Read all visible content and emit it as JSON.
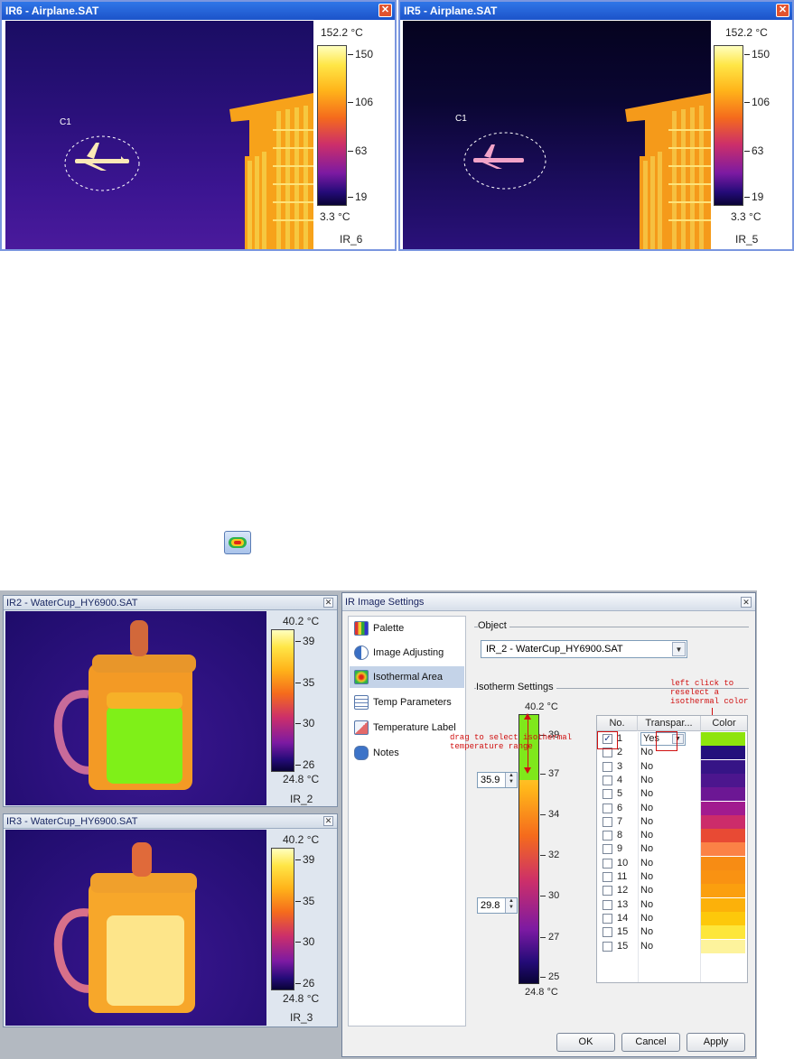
{
  "top_left_window": {
    "title": "IR6 - Airplane.SAT",
    "max_label": "152.2 °C",
    "min_label": "3.3 °C",
    "ticks": [
      "150",
      "106",
      "63",
      "19"
    ],
    "image_name": "IR_6",
    "region_label": "C1"
  },
  "top_right_window": {
    "title": "IR5 - Airplane.SAT",
    "max_label": "152.2 °C",
    "min_label": "3.3 °C",
    "ticks": [
      "150",
      "106",
      "63",
      "19"
    ],
    "image_name": "IR_5",
    "region_label": "C1"
  },
  "isothermal_toolbar_icon": "isothermal-area-icon",
  "cup_window_top": {
    "title": "IR2 - WaterCup_HY6900.SAT",
    "max_label": "40.2 °C",
    "min_label": "24.8 °C",
    "ticks": [
      "39",
      "35",
      "30",
      "26"
    ],
    "image_name": "IR_2"
  },
  "cup_window_bottom": {
    "title": "IR3 - WaterCup_HY6900.SAT",
    "max_label": "40.2 °C",
    "min_label": "24.8 °C",
    "ticks": [
      "39",
      "35",
      "30",
      "26"
    ],
    "image_name": "IR_3"
  },
  "dialog": {
    "title": "IR Image Settings",
    "nav": [
      {
        "label": "Palette",
        "icon": "palette-icon"
      },
      {
        "label": "Image Adjusting",
        "icon": "contrast-icon"
      },
      {
        "label": "Isothermal Area",
        "icon": "isothermal-icon",
        "selected": true
      },
      {
        "label": "Temp Parameters",
        "icon": "list-icon"
      },
      {
        "label": "Temperature Label",
        "icon": "label-icon"
      },
      {
        "label": "Notes",
        "icon": "notes-icon"
      }
    ],
    "object_group": "Object",
    "object_value": "IR_2 - WaterCup_HY6900.SAT",
    "isotherm_group": "Isotherm Settings",
    "scale_max": "40.2 °C",
    "scale_min": "24.8 °C",
    "scale_ticks": [
      "39",
      "37",
      "34",
      "32",
      "30",
      "27",
      "25"
    ],
    "upper_value": "35.9",
    "lower_value": "29.8",
    "annotation_drag": "drag to select isothermal temperature range",
    "annotation_color": "left click to reselect a isothermal color",
    "table_headers": [
      "No.",
      "Transpar...",
      "Color"
    ],
    "rows": [
      {
        "no": "1",
        "transparency": "Yes",
        "color": "#8ee40d",
        "checked": true
      },
      {
        "no": "2",
        "transparency": "No",
        "color": "#23107c",
        "checked": false
      },
      {
        "no": "3",
        "transparency": "No",
        "color": "#361486",
        "checked": false
      },
      {
        "no": "4",
        "transparency": "No",
        "color": "#4c168e",
        "checked": false
      },
      {
        "no": "5",
        "transparency": "No",
        "color": "#6c1794",
        "checked": false
      },
      {
        "no": "6",
        "transparency": "No",
        "color": "#a11b8f",
        "checked": false
      },
      {
        "no": "7",
        "transparency": "No",
        "color": "#cc2c6a",
        "checked": false
      },
      {
        "no": "8",
        "transparency": "No",
        "color": "#e84a34",
        "checked": false
      },
      {
        "no": "9",
        "transparency": "No",
        "color": "#fb8246",
        "checked": false
      },
      {
        "no": "10",
        "transparency": "No",
        "color": "#f78c14",
        "checked": false
      },
      {
        "no": "11",
        "transparency": "No",
        "color": "#f99212",
        "checked": false
      },
      {
        "no": "12",
        "transparency": "No",
        "color": "#fb9f0e",
        "checked": false
      },
      {
        "no": "13",
        "transparency": "No",
        "color": "#fcb10a",
        "checked": false
      },
      {
        "no": "14",
        "transparency": "No",
        "color": "#fdc80b",
        "checked": false
      },
      {
        "no": "15",
        "transparency": "No",
        "color": "#fde63a",
        "checked": false
      },
      {
        "no": "15",
        "transparency": "No",
        "color": "#fdf39c",
        "checked": false
      }
    ],
    "buttons": {
      "ok": "OK",
      "cancel": "Cancel",
      "apply": "Apply"
    }
  }
}
